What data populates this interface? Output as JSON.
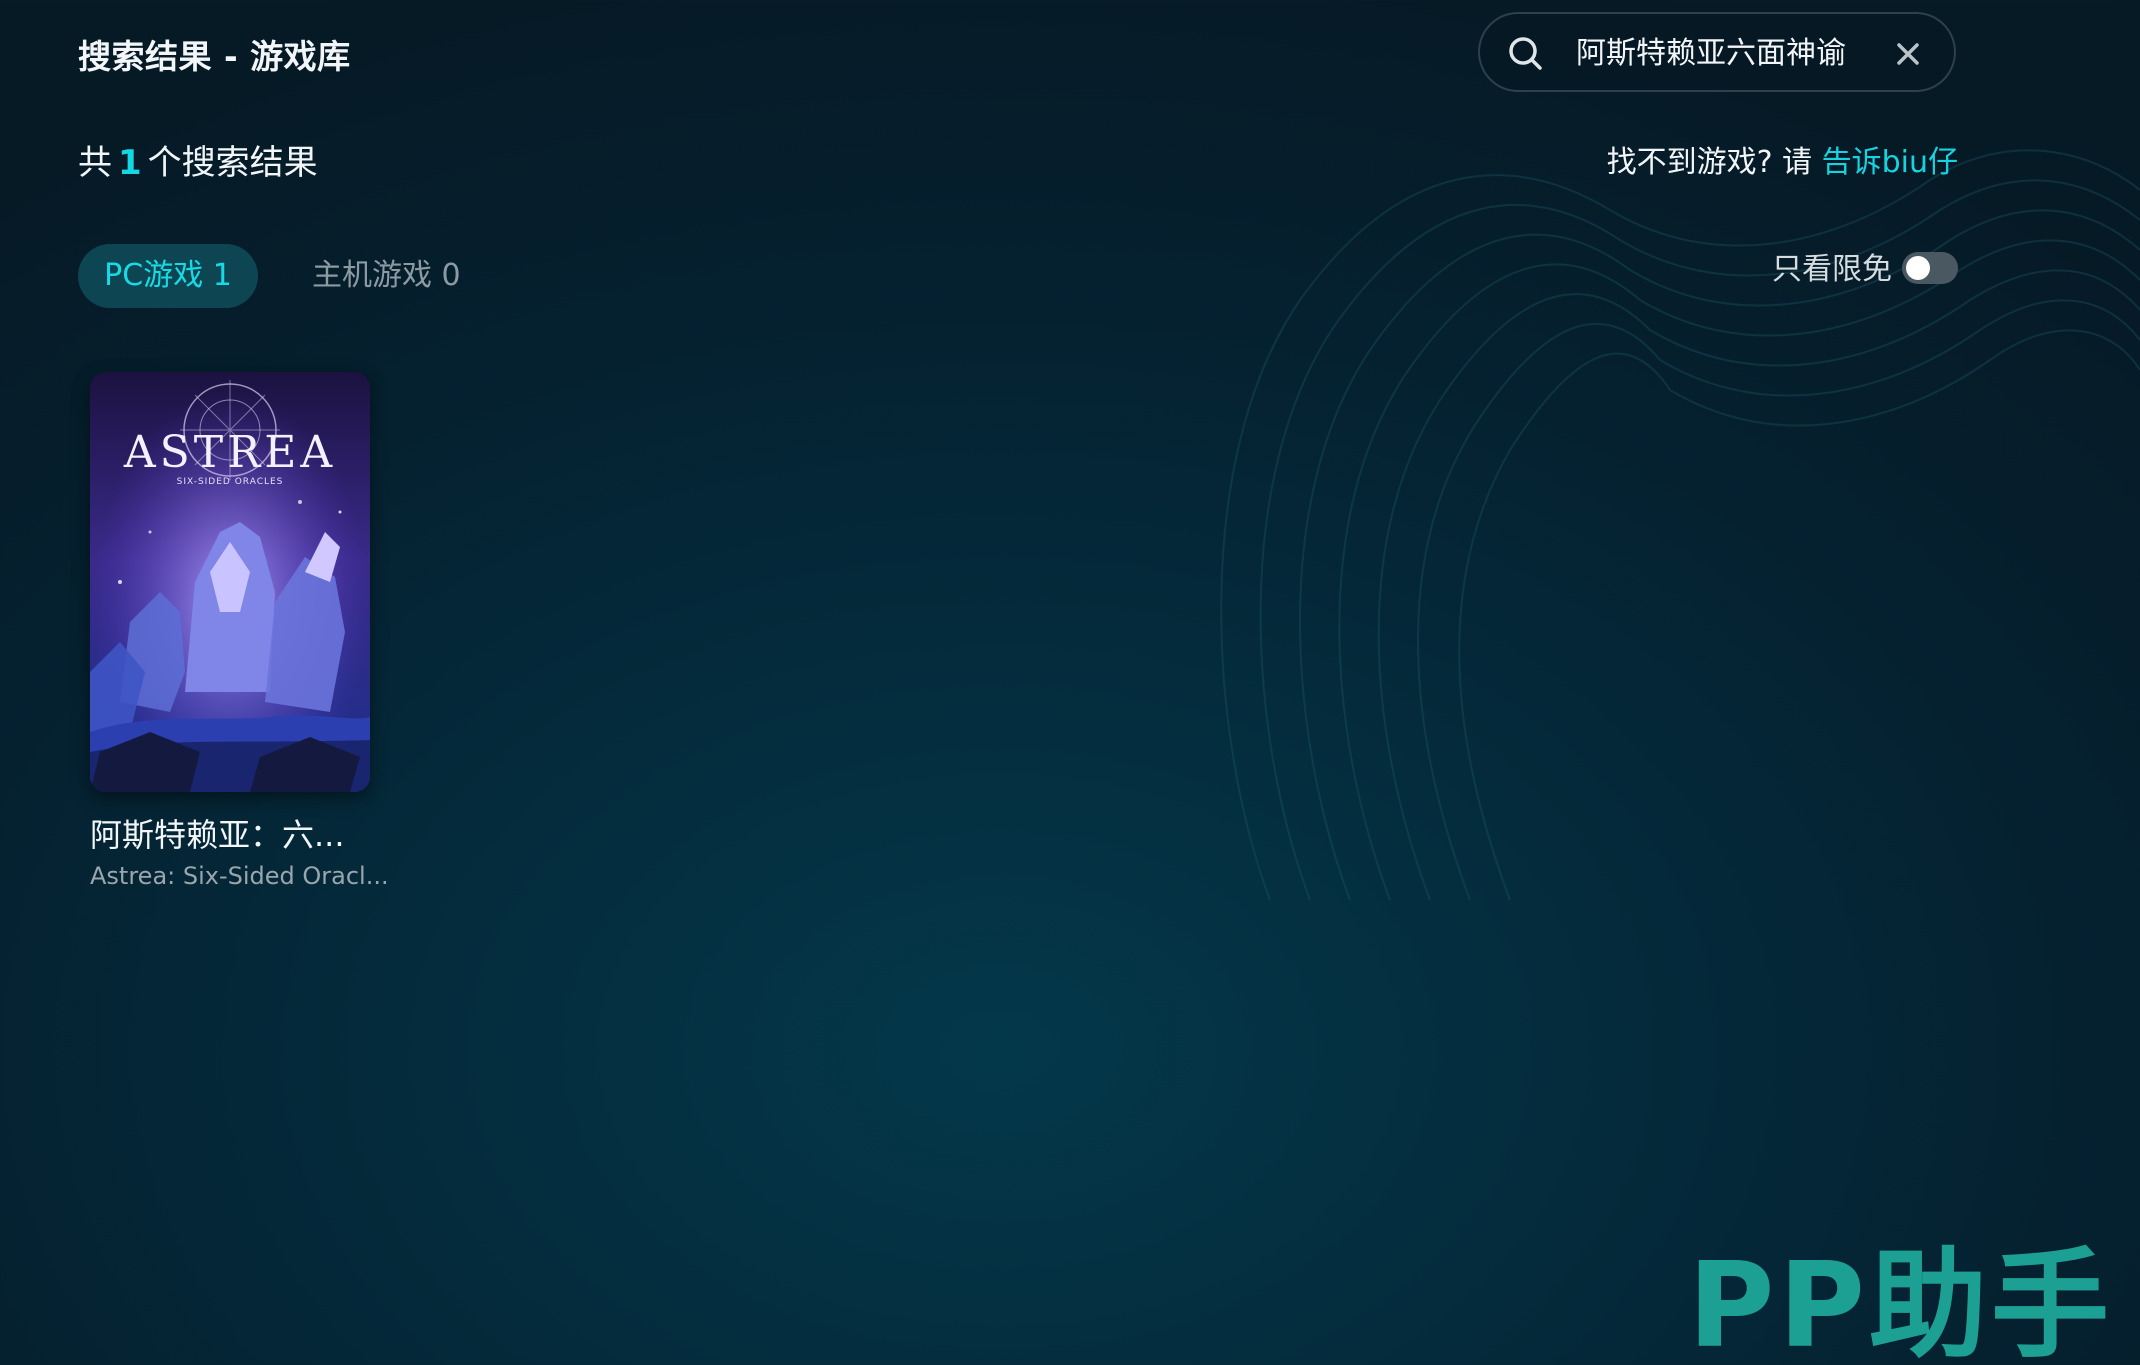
{
  "header": {
    "title": "搜索结果 - 游戏库"
  },
  "search": {
    "value": "阿斯特赖亚六面神谕"
  },
  "results": {
    "prefix": "共",
    "count": "1",
    "suffix": "个搜索结果"
  },
  "feedback": {
    "text": "找不到游戏? 请",
    "link": "告诉biu仔"
  },
  "tabs": [
    {
      "label": "PC游戏 1",
      "active": true
    },
    {
      "label": "主机游戏 0",
      "active": false
    }
  ],
  "filter": {
    "free_only_label": "只看限免",
    "free_only_on": false
  },
  "games": [
    {
      "name": "阿斯特赖亚：六...",
      "en_name": "Astrea: Six-Sided Oracl...",
      "cover_logo": "ASTREA",
      "cover_sub": "SIX-SIDED ORACLES"
    }
  ],
  "watermark": "PP助手",
  "colors": {
    "accent": "#13d8e3",
    "tab_active_bg": "#0e4552",
    "watermark": "#1fa79a"
  }
}
